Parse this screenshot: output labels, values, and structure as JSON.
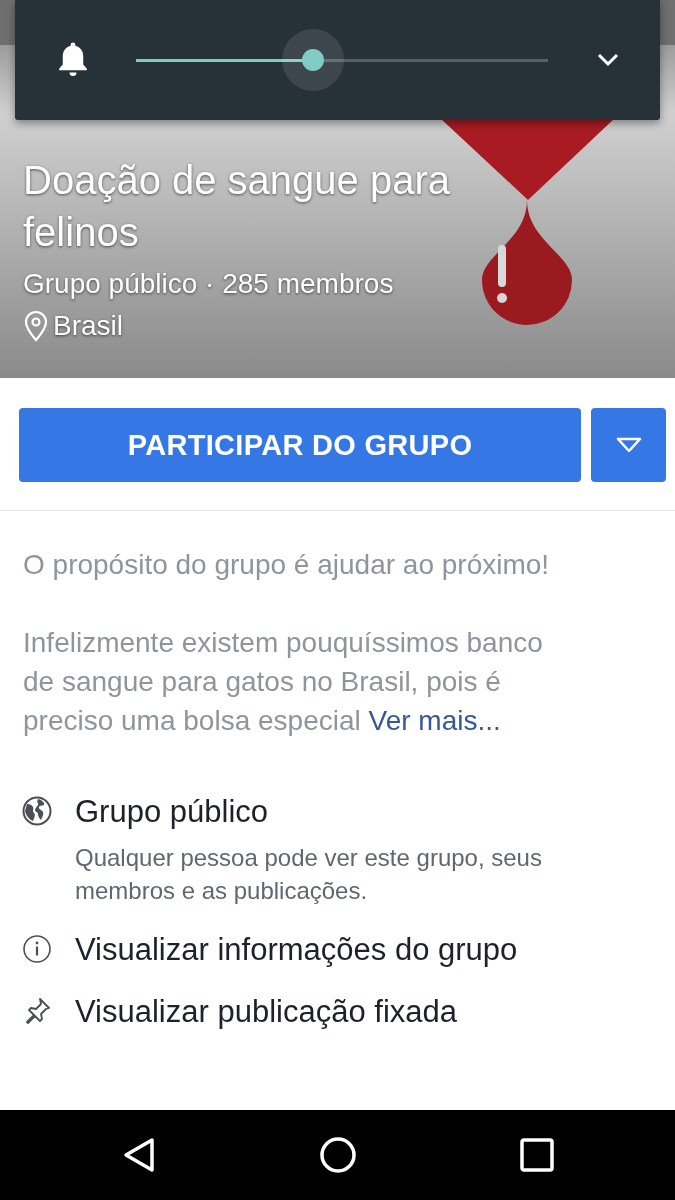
{
  "volume_panel": {
    "level": 0.43
  },
  "group": {
    "title": "Doação de sangue para felinos",
    "meta": "Grupo público · 285 membros",
    "location": "Brasil"
  },
  "join_button": {
    "label": "PARTICIPAR DO GRUPO"
  },
  "description": {
    "paragraphs": [
      "O propósito do grupo é ajudar ao próximo!",
      "Infelizmente existem pouquíssimos banco de sangue para gatos no Brasil, pois é preciso uma bolsa especial"
    ],
    "see_more": "Ver mais..."
  },
  "info_items": [
    {
      "kind": "globe",
      "title": "Grupo público",
      "subtitle": "Qualquer pessoa pode ver este grupo, seus membros e as publicações."
    },
    {
      "kind": "info",
      "title": "Visualizar informações do grupo"
    },
    {
      "kind": "pin",
      "title": "Visualizar publicação fixada"
    }
  ]
}
